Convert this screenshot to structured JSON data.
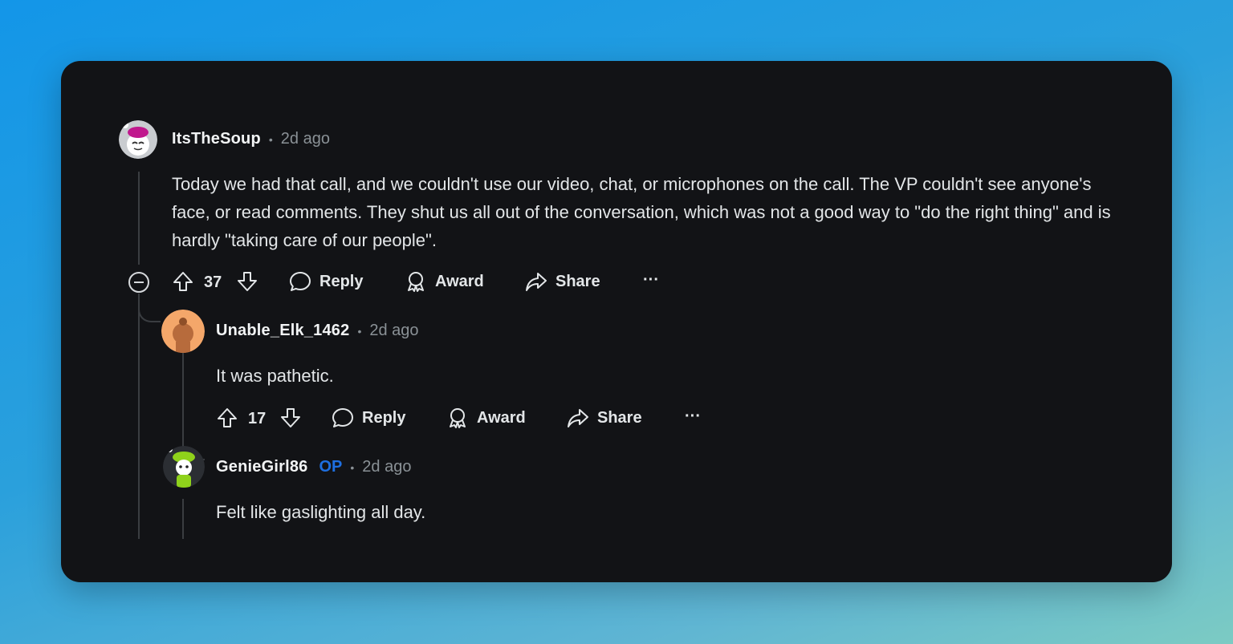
{
  "comments": [
    {
      "username": "ItsTheSoup",
      "time": "2d ago",
      "text": "Today we had that call, and we couldn't use our video, chat, or microphones on the call. The VP couldn't see anyone's face, or read comments. They shut us all out of the conversation, which was not a good way to \"do the right thing\" and is hardly \"taking care of our people\".",
      "score": "37",
      "reply_label": "Reply",
      "award_label": "Award",
      "share_label": "Share",
      "more_label": "···"
    },
    {
      "username": "Unable_Elk_1462",
      "time": "2d ago",
      "text": "It was pathetic.",
      "score": "17",
      "reply_label": "Reply",
      "award_label": "Award",
      "share_label": "Share",
      "more_label": "···"
    },
    {
      "username": "GenieGirl86",
      "badge": "OP",
      "time": "2d ago",
      "text": "Felt like gaslighting all day."
    }
  ],
  "separator": "•",
  "colors": {
    "card_background": "#121316",
    "op_badge": "#1e6fe0",
    "avatar_orange": "#f4a76a",
    "avatar_green": "#8fd21b"
  },
  "icons": [
    "collapse-icon",
    "upvote-icon",
    "downvote-icon",
    "reply-icon",
    "award-icon",
    "share-icon",
    "more-icon"
  ]
}
